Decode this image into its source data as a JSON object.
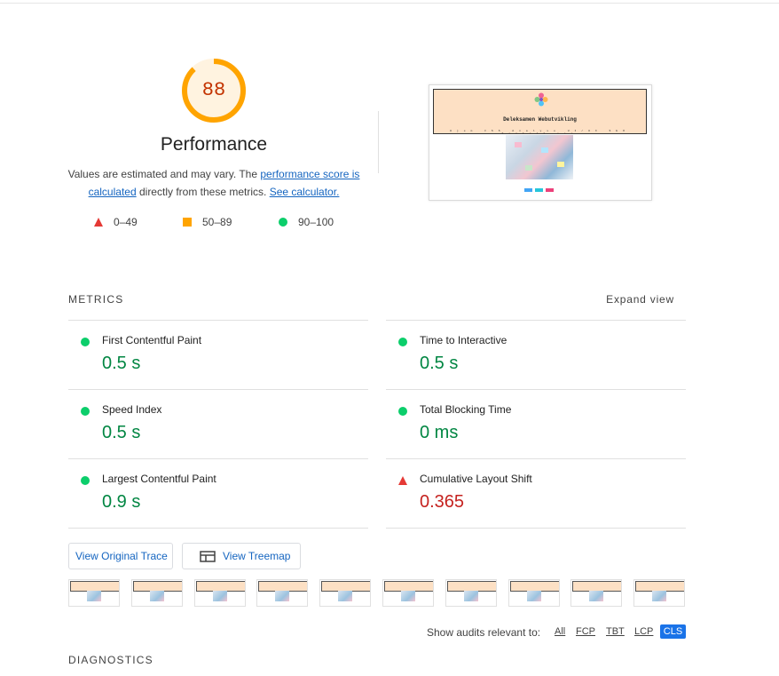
{
  "performance": {
    "score": "88",
    "title": "Performance",
    "description": {
      "text1": "Values are estimated and may vary. The ",
      "link1": "performance score is calculated",
      "text2": " directly from these metrics. ",
      "link2": "See calculator."
    },
    "legend": [
      {
        "label": "0–49",
        "shape": "triangle",
        "color": "#e53935"
      },
      {
        "label": "50–89",
        "shape": "square",
        "color": "#ffa400"
      },
      {
        "label": "90–100",
        "shape": "circle",
        "color": "#0cce6b"
      }
    ]
  },
  "preview": {
    "site_title": "Deleksamen Webutvikling",
    "nav": "Hjem CSS Analyse UI/UX SEO Kontakt oss"
  },
  "metrics": {
    "section_label": "METRICS",
    "expand_label": "Expand view",
    "items": [
      {
        "name": "First Contentful Paint",
        "value": "0.5 s",
        "status": "pass"
      },
      {
        "name": "Time to Interactive",
        "value": "0.5 s",
        "status": "pass"
      },
      {
        "name": "Speed Index",
        "value": "0.5 s",
        "status": "pass"
      },
      {
        "name": "Total Blocking Time",
        "value": "0 ms",
        "status": "pass"
      },
      {
        "name": "Largest Contentful Paint",
        "value": "0.9 s",
        "status": "pass"
      },
      {
        "name": "Cumulative Layout Shift",
        "value": "0.365",
        "status": "fail"
      }
    ]
  },
  "buttons": {
    "original_trace": "View Original Trace",
    "treemap": "View Treemap"
  },
  "filmstrip": {
    "frames": 10
  },
  "filter": {
    "label": "Show audits relevant to:",
    "chips": [
      "All",
      "FCP",
      "TBT",
      "LCP"
    ],
    "active": "CLS"
  },
  "diagnostics": {
    "label": "DIAGNOSTICS"
  },
  "colors": {
    "pass": "#0cce6b",
    "average": "#ffa400",
    "fail": "#e53935",
    "link": "#1565c0"
  }
}
